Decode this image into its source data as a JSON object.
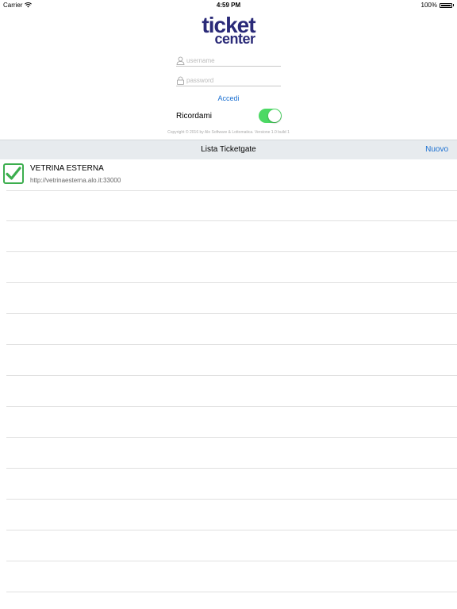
{
  "status_bar": {
    "carrier": "Carrier",
    "time": "4:59 PM",
    "battery": "100%"
  },
  "logo": {
    "line1": "ticket",
    "line2": "center"
  },
  "login": {
    "username_placeholder": "username",
    "password_placeholder": "password",
    "login_button": "Accedi",
    "remember_label": "Ricordami",
    "remember_on": true,
    "copyright": "Copyright © 2016 by Alo Software & Lottomatica. Versione 1.0 build 1"
  },
  "navbar": {
    "title": "Lista Ticketgate",
    "new_button": "Nuovo"
  },
  "ticketgates": [
    {
      "name": "VETRINA ESTERNA",
      "url": "http://vetrinaesterna.alo.it:33000",
      "checked": true
    }
  ],
  "colors": {
    "accent": "#1a6fd1",
    "toggle_on": "#4cd964",
    "check_green": "#3cae4e",
    "logo": "#2a2a78",
    "navbar_bg": "#e7ebee"
  }
}
